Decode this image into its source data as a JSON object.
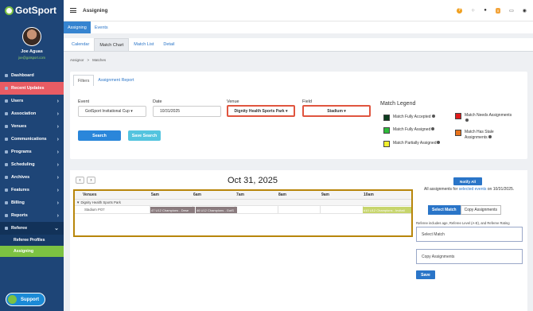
{
  "app": {
    "logo_text": "GotSport"
  },
  "user": {
    "name": "Joe Aguas",
    "email": "joe@gotsport.com"
  },
  "sidebar": {
    "items": [
      {
        "label": "Dashboard"
      },
      {
        "label": "Recent Updates"
      },
      {
        "label": "Users"
      },
      {
        "label": "Association"
      },
      {
        "label": "Venues"
      },
      {
        "label": "Communications"
      },
      {
        "label": "Programs"
      },
      {
        "label": "Scheduling"
      },
      {
        "label": "Archives"
      },
      {
        "label": "Features"
      },
      {
        "label": "Billing"
      },
      {
        "label": "Reports"
      },
      {
        "label": "Referee"
      }
    ],
    "subitems": [
      {
        "label": "Referee Profiles"
      },
      {
        "label": "Assigning"
      }
    ],
    "support_label": "Support"
  },
  "topbar": {
    "title": "Assigning",
    "help_icon": "?",
    "mail_count": "0"
  },
  "module_tabs": [
    {
      "label": "Assigning"
    },
    {
      "label": "Events"
    }
  ],
  "sub_tabs": [
    {
      "label": "Calendar"
    },
    {
      "label": "Match Chart"
    },
    {
      "label": "Match List"
    },
    {
      "label": "Detail"
    }
  ],
  "breadcrumb": {
    "root": "Assignor",
    "sep": ">",
    "current": "Matches"
  },
  "filters": {
    "tabs": [
      {
        "label": "Filters"
      },
      {
        "label": "Assignment Report"
      }
    ],
    "event": {
      "label": "Event",
      "value": "GotSport Invitational Cup ▾"
    },
    "date": {
      "label": "Date",
      "value": "10/31/2025"
    },
    "venue": {
      "label": "Venue",
      "value": "Dignity Health Sports Park ▾"
    },
    "field": {
      "label": "Field",
      "value": "Stadium ▾"
    },
    "search_label": "Search",
    "save_search_label": "Save Search"
  },
  "legend": {
    "title": "Match Legend",
    "items": [
      {
        "label": "Match Fully Accepted",
        "color": "#0d3d1f"
      },
      {
        "label": "Match Fully Assigned",
        "color": "#2dbb3a"
      },
      {
        "label": "Match Partially Assigned",
        "color": "#f2f02e"
      },
      {
        "label": "Match Needs Assignments",
        "color": "#e11b1b"
      },
      {
        "label": "Match Has Stale Assignments",
        "color": "#e8731b"
      }
    ]
  },
  "calendar": {
    "prev": "‹",
    "next": "›",
    "date_title": "Oct 31, 2025",
    "header": {
      "venues": "Venues",
      "times": [
        "5am",
        "6am",
        "7am",
        "8am",
        "9am",
        "10am"
      ]
    },
    "group": "▼ Dignity Health Sports Park",
    "venue_row": "Stadium PO7",
    "matches": [
      {
        "text": "47 U12 Champions - Dese"
      },
      {
        "text": "46 U12 Champions - GotS"
      },
      {
        "text": "#10 U12 Champions - Invitati"
      }
    ]
  },
  "assign": {
    "notify_all": "Notify All",
    "note_prefix": "All assignments for",
    "note_link": "selected events",
    "note_suffix": "on 10/31/2025.",
    "select_match": "Select Match",
    "copy_assignments": "Copy Assignments",
    "ref_note": "Referee includes age, Referee Level (A-E), and Referee Rating",
    "select_box": "Select Match",
    "copy_box": "Copy Assignments",
    "save": "Save"
  }
}
